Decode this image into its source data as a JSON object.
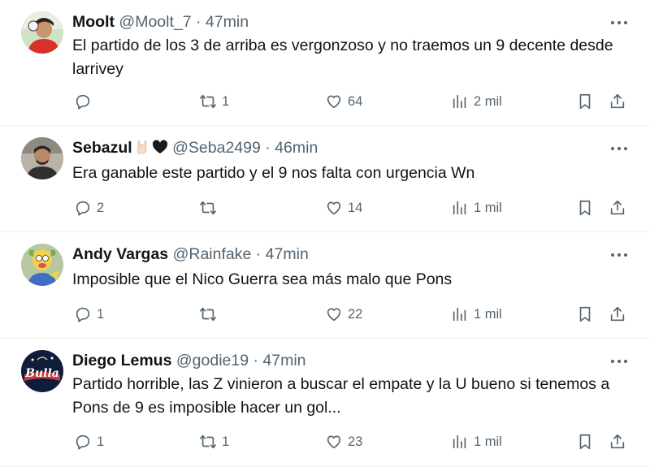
{
  "tweets": [
    {
      "name": "Moolt",
      "handle": "@Moolt_7",
      "sep": "·",
      "time": "47min",
      "text": "El partido de los 3 de arriba es vergonzoso y no traemos un 9 decente desde larrivey",
      "replies": "",
      "retweets": "1",
      "likes": "64",
      "views": "2 mil"
    },
    {
      "name": "Sebazul",
      "handle": "@Seba2499",
      "sep": "·",
      "time": "46min",
      "text": "Era ganable este partido y el 9 nos falta con urgencia Wn",
      "replies": "2",
      "retweets": "",
      "likes": "14",
      "views": "1 mil"
    },
    {
      "name": "Andy Vargas",
      "handle": "@Rainfake",
      "sep": "·",
      "time": "47min",
      "text": "Imposible que el Nico Guerra sea más malo que Pons",
      "replies": "1",
      "retweets": "",
      "likes": "22",
      "views": "1 mil"
    },
    {
      "name": "Diego Lemus",
      "handle": "@godie19",
      "sep": "·",
      "time": "47min",
      "text": "Partido horrible, las Z vinieron a buscar el empate y la U bueno si tenemos a Pons de 9 es imposible hacer un gol...",
      "replies": "1",
      "retweets": "1",
      "likes": "23",
      "views": "1 mil",
      "avatar_text": "Bulla"
    }
  ],
  "colors": {
    "text": "#0f1419",
    "secondary": "#536471",
    "divider": "#eff3f4"
  }
}
